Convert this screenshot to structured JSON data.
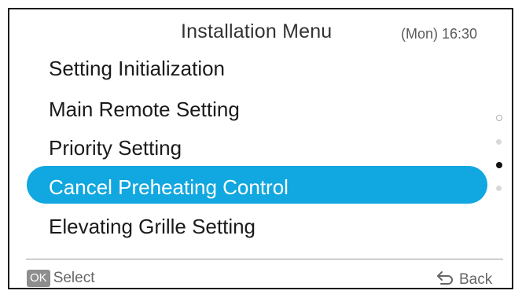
{
  "header": {
    "title": "Installation Menu",
    "clock": "(Mon) 16:30"
  },
  "menu": {
    "items": [
      {
        "label": "Setting Initialization",
        "selected": false
      },
      {
        "label": "Main Remote Setting",
        "selected": false
      },
      {
        "label": "Priority Setting",
        "selected": false
      },
      {
        "label": "Cancel Preheating Control",
        "selected": true
      },
      {
        "label": "Elevating Grille Setting",
        "selected": false
      }
    ],
    "page_indicator": {
      "pages": 4,
      "current": 3
    }
  },
  "footer": {
    "ok_badge": "OK",
    "select_label": "Select",
    "back_label": "Back",
    "back_icon": "return-arrow-icon"
  },
  "colors": {
    "selection": "#11a7e0",
    "text": "#1a1a1a",
    "muted": "#666666",
    "border": "#1b1b1b"
  }
}
